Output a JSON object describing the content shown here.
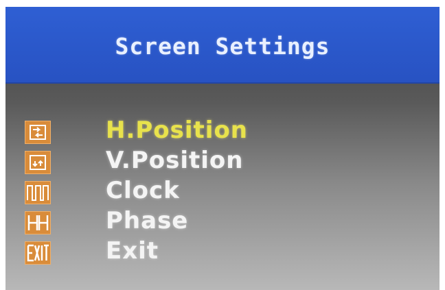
{
  "header": {
    "title": "Screen  Settings"
  },
  "menu": {
    "items": [
      {
        "label": "H.Position",
        "icon": "horizontal-position-icon",
        "selected": true
      },
      {
        "label": "V.Position",
        "icon": "vertical-position-icon",
        "selected": false
      },
      {
        "label": "Clock",
        "icon": "clock-waveform-icon",
        "selected": false
      },
      {
        "label": "Phase",
        "icon": "phase-icon",
        "selected": false
      },
      {
        "label": "Exit",
        "icon": "exit-icon",
        "selected": false
      }
    ]
  },
  "colors": {
    "header_blue": "#2a57c9",
    "selected_text": "#e8e24c",
    "normal_text": "#f4f4f4",
    "icon_orange": "#d98c3a"
  }
}
